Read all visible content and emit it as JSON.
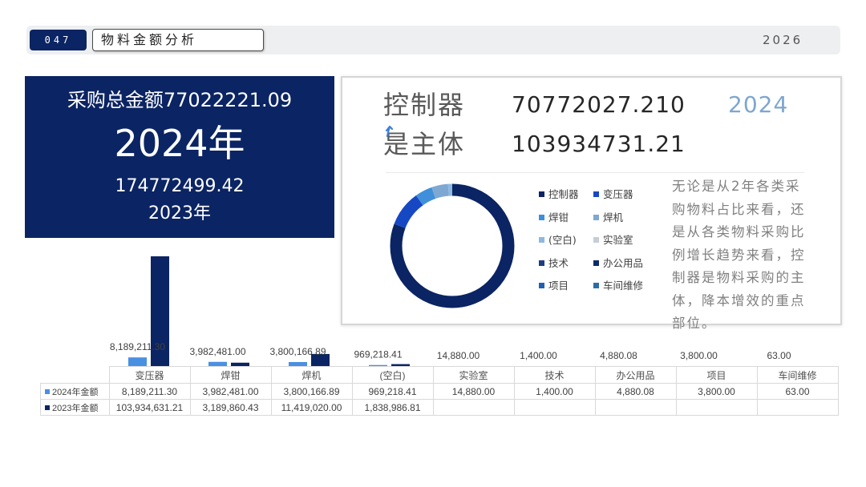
{
  "header": {
    "section_number": "047",
    "title": "物料金额分析",
    "year": "2026"
  },
  "summary_panel": {
    "total_2024": "采购总金额77022221.09",
    "year_2024": "2024年",
    "total_2023": "174772499.42",
    "year_2023": "2023年"
  },
  "highlight_card": {
    "label_1": "控制器",
    "value_1": "70772027.210",
    "year_tag": "2024",
    "label_2": "是主体",
    "value_2": "103934731.21",
    "mark_icon": "blue-mark-icon",
    "body_lines": [
      "无论是从2年各类采",
      "购物料占比来看，还",
      "是从各类物料采购比",
      "例增长趋势来看，控",
      "制器是物料采购的主",
      "体，降本增效的重点",
      "部位。"
    ]
  },
  "colors": {
    "navy": "#0B2463",
    "header_bg": "#EEEFF1",
    "year_tag": "#7EA6CF"
  },
  "chart_data": [
    {
      "type": "bar",
      "categories": [
        "变压器",
        "焊钳",
        "焊机",
        "(空白)",
        "实验室",
        "技术",
        "办公用品",
        "项目",
        "车间维修"
      ],
      "series": [
        {
          "name": "2024年金额",
          "color": "#4A90E2",
          "data_labels": true,
          "values": [
            8189211.3,
            3982481.0,
            3800166.89,
            969218.41,
            14880.0,
            1400.0,
            4880.08,
            3800.0,
            63.0
          ]
        },
        {
          "name": "2023年金额",
          "color": "#0B2463",
          "data_labels": false,
          "values": [
            103934631.21,
            3189860.43,
            11419020.0,
            1838986.81,
            null,
            null,
            null,
            null,
            null
          ]
        }
      ],
      "data_table": true,
      "grid": false
    },
    {
      "type": "pie",
      "donut": true,
      "labels": [
        "控制器",
        "变压器",
        "焊钳",
        "焊机",
        "(空白)",
        "实验室",
        "技术",
        "办公用品",
        "项目",
        "车间维修"
      ],
      "values": [
        80.7,
        9.3,
        4.5,
        4.3,
        1.1,
        0.02,
        0,
        0.01,
        0,
        0
      ],
      "colors": [
        "#0B2463",
        "#1748C4",
        "#3F8FDB",
        "#7EA8D2",
        "#8CB9E3",
        "#C7CDD6",
        "#1D3C82",
        "#0D2A6A",
        "#2060B0",
        "#2B6CA8"
      ],
      "legend": "right"
    }
  ]
}
